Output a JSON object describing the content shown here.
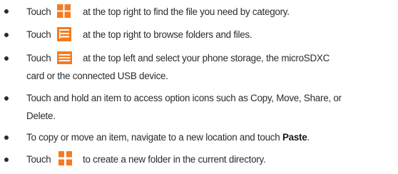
{
  "items": [
    {
      "before": "Touch",
      "icon": "grid-category-icon",
      "after": "at the top right to find the file you need by category."
    },
    {
      "before": "Touch",
      "icon": "list-view-icon",
      "after": "at the top right to browse folders and files."
    },
    {
      "before": "Touch",
      "icon": "menu-icon",
      "after": "at the top left and select your phone storage, the microSDXC",
      "continuation": "card or the connected USB device."
    },
    {
      "line1": "Touch and hold an item to access option icons such as Copy, Move, Share, or",
      "line2": "Delete."
    },
    {
      "before": "To copy or move an item, navigate to a new location and touch",
      "bold": "Paste",
      "after": "."
    },
    {
      "before": "Touch",
      "icon": "add-folder-icon",
      "after": "to create a new folder in the current directory."
    }
  ],
  "colors": {
    "icon_orange": "#f47b20",
    "text": "#2b2b2b"
  }
}
